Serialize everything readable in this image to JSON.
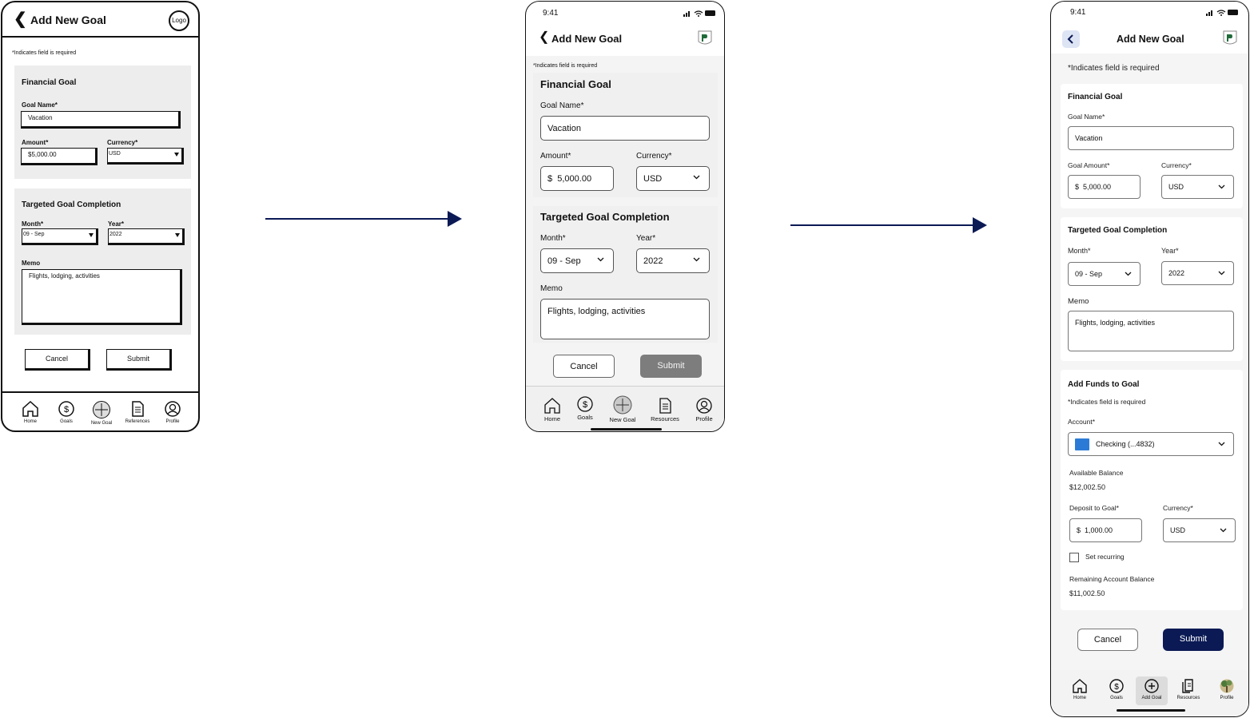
{
  "colors": {
    "navy": "#0b1a55",
    "grey_button": "#7d7d7d",
    "light_grey": "#f4f4f4"
  },
  "wireframe": {
    "title": "Add New Goal",
    "logo_label": "Logo",
    "required_note": "*Indicates field is required",
    "financial_goal": {
      "title": "Financial Goal",
      "goal_name_label": "Goal Name*",
      "goal_name_value": "Vacation",
      "amount_label": "Amount*",
      "amount_value": "$5,000.00",
      "currency_label": "Currency*",
      "currency_value": "USD"
    },
    "target": {
      "title": "Targeted Goal Completion",
      "month_label": "Month*",
      "month_value": "09 - Sep",
      "year_label": "Year*",
      "year_value": "2022",
      "memo_label": "Memo",
      "memo_value": "Flights, lodging, activities"
    },
    "cancel_label": "Cancel",
    "submit_label": "Submit",
    "nav": [
      "Home",
      "Goals",
      "New Goal",
      "References",
      "Profile"
    ]
  },
  "midfi": {
    "time": "9:41",
    "title": "Add New Goal",
    "required_note": "*Indicates field is required",
    "financial_goal": {
      "title": "Financial Goal",
      "goal_name_label": "Goal Name*",
      "goal_name_value": "Vacation",
      "amount_label": "Amount*",
      "amount_prefix": "$",
      "amount_value": "5,000.00",
      "currency_label": "Currency*",
      "currency_value": "USD"
    },
    "target": {
      "title": "Targeted Goal Completion",
      "month_label": "Month*",
      "month_value": "09 - Sep",
      "year_label": "Year*",
      "year_value": "2022",
      "memo_label": "Memo",
      "memo_value": "Flights, lodging, activities"
    },
    "cancel_label": "Cancel",
    "submit_label": "Submit",
    "nav": [
      "Home",
      "Goals",
      "New Goal",
      "Resources",
      "Profile"
    ]
  },
  "hifi": {
    "time": "9:41",
    "title": "Add New Goal",
    "required_note": "*Indicates field is required",
    "financial_goal": {
      "title": "Financial Goal",
      "goal_name_label": "Goal Name*",
      "goal_name_value": "Vacation",
      "amount_label": "Goal Amount*",
      "amount_prefix": "$",
      "amount_value": "5,000.00",
      "currency_label": "Currency*",
      "currency_value": "USD"
    },
    "target": {
      "title": "Targeted Goal Completion",
      "month_label": "Month*",
      "month_value": "09 - Sep",
      "year_label": "Year*",
      "year_value": "2022",
      "memo_label": "Memo",
      "memo_value": "Flights, lodging, activities"
    },
    "funds": {
      "title": "Add Funds to Goal",
      "required_note": "*Indicates field is required",
      "account_label": "Account*",
      "account_value": "Checking (...4832)",
      "available_label": "Available Balance",
      "available_value": "$12,002.50",
      "deposit_label": "Deposit to Goal*",
      "deposit_prefix": "$",
      "deposit_value": "1,000.00",
      "currency_label": "Currency*",
      "currency_value": "USD",
      "recurring_label": "Set recurring",
      "recurring_checked": false,
      "remaining_label": "Remaining Account Balance",
      "remaining_value": "$11,002.50"
    },
    "cancel_label": "Cancel",
    "submit_label": "Submit",
    "nav": [
      "Home",
      "Goals",
      "Add Goal",
      "Resources",
      "Profile"
    ],
    "active_nav": "Add Goal"
  }
}
